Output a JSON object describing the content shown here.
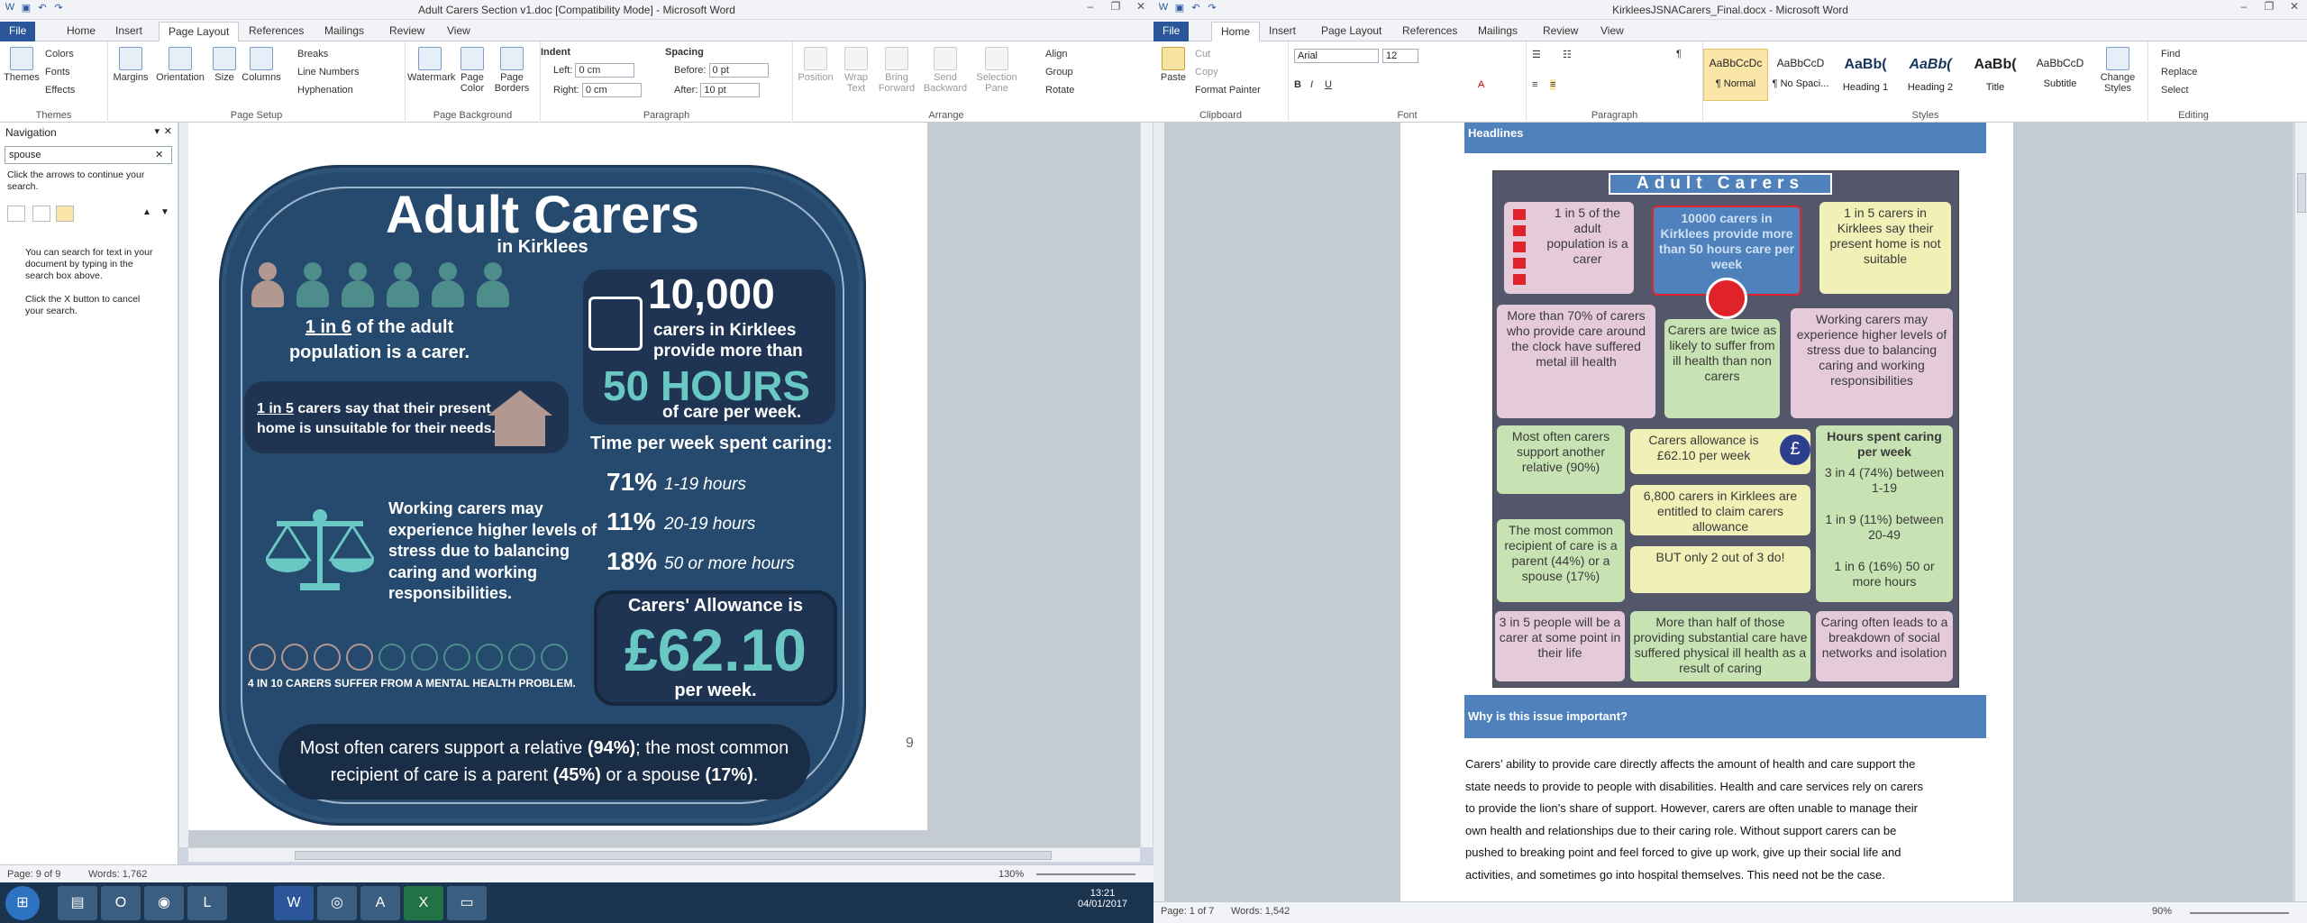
{
  "left_window": {
    "title": "Adult Carers Section v1.doc [Compatibility Mode] - Microsoft Word",
    "tabs": [
      "File",
      "Home",
      "Insert",
      "Page Layout",
      "References",
      "Mailings",
      "Review",
      "View"
    ],
    "active_tab": "Page Layout",
    "ribbon": {
      "themes": {
        "label": "Themes",
        "btn": "Themes",
        "colors": "Colors",
        "fonts": "Fonts",
        "effects": "Effects"
      },
      "page_setup": {
        "label": "Page Setup",
        "margins": "Margins",
        "orientation": "Orientation",
        "size": "Size",
        "columns": "Columns",
        "breaks": "Breaks",
        "line_numbers": "Line Numbers",
        "hyphenation": "Hyphenation"
      },
      "page_background": {
        "label": "Page Background",
        "watermark": "Watermark",
        "page_color": "Page Color",
        "page_borders": "Page Borders"
      },
      "paragraph": {
        "label": "Paragraph",
        "indent": "Indent",
        "left": "Left:",
        "left_val": "0 cm",
        "right": "Right:",
        "right_val": "0 cm",
        "spacing": "Spacing",
        "before": "Before:",
        "before_val": "0 pt",
        "after": "After:",
        "after_val": "10 pt"
      },
      "arrange": {
        "label": "Arrange",
        "position": "Position",
        "wrap": "Wrap Text",
        "bring": "Bring Forward",
        "send": "Send Backward",
        "selection": "Selection Pane",
        "align": "Align",
        "group": "Group",
        "rotate": "Rotate"
      }
    },
    "navigation": {
      "title": "Navigation",
      "search_value": "spouse",
      "hint": "Click the arrows to continue your search.",
      "info1": "You can search for text in your document by typing in the search box above.",
      "info2": "Click the X button to cancel your search."
    },
    "page_number": "9",
    "status": {
      "page": "Page: 9 of 9",
      "words": "Words: 1,762",
      "zoom": "130%"
    },
    "infographic": {
      "title": "Adult Carers",
      "subtitle": "in Kirklees",
      "one_in_6_a": "1 in 6",
      "one_in_6_b": " of the adult",
      "one_in_6_c": "population is a carer.",
      "big_num": "10,000",
      "carers_line1": "carers in Kirklees",
      "carers_line2": "provide more than",
      "fifty": "50 HOURS",
      "care_week": "of care per week.",
      "home_a": "1 in 5",
      "home_b": " carers say that their present",
      "home_c": "home is unsuitable for their needs.",
      "time_title": "Time per week spent caring:",
      "pct1": "71%",
      "pct1_l": "1-19 hours",
      "pct2": "11%",
      "pct2_l": "20-19 hours",
      "pct3": "18%",
      "pct3_l": "50 or more hours",
      "stress1": "Working carers may",
      "stress2": "experience higher levels of",
      "stress3": "stress due to balancing",
      "stress4": "caring and working",
      "stress5": "responsibilities.",
      "mental": "4 IN 10 CARERS SUFFER FROM A MENTAL HEALTH PROBLEM.",
      "allow_title": "Carers' Allowance is",
      "allow_value": "£62.10",
      "allow_per": "per week.",
      "relative_a": "Most often carers support a relative ",
      "relative_b": "(94%)",
      "relative_c": "; the most common",
      "relative_d": "recipient of care is a parent ",
      "relative_e": "(45%)",
      "relative_f": " or a spouse ",
      "relative_g": "(17%)",
      "relative_h": "."
    }
  },
  "right_window": {
    "title": "KirkleesJSNACarers_Final.docx - Microsoft Word",
    "tabs": [
      "File",
      "Home",
      "Insert",
      "Page Layout",
      "References",
      "Mailings",
      "Review",
      "View"
    ],
    "active_tab": "Home",
    "ribbon": {
      "clipboard": {
        "label": "Clipboard",
        "paste": "Paste",
        "cut": "Cut",
        "copy": "Copy",
        "format_painter": "Format Painter"
      },
      "font": {
        "label": "Font",
        "name": "Arial",
        "size": "12"
      },
      "paragraph": {
        "label": "Paragraph"
      },
      "styles": {
        "label": "Styles",
        "items": [
          {
            "sample": "AaBbCcDc",
            "name": "¶ Normal"
          },
          {
            "sample": "AaBbCcD",
            "name": "¶ No Spaci..."
          },
          {
            "sample": "AaBb(",
            "name": "Heading 1"
          },
          {
            "sample": "AaBb(",
            "name": "Heading 2"
          },
          {
            "sample": "AaBb(",
            "name": "Title"
          },
          {
            "sample": "AaBbCcD",
            "name": "Subtitle"
          }
        ],
        "change": "Change Styles"
      },
      "editing": {
        "label": "Editing",
        "find": "Find",
        "replace": "Replace",
        "select": "Select"
      }
    },
    "doc": {
      "headlines": "Headlines",
      "ig_title": "Adult Carers",
      "c1": "1 in 5 of the adult population is a carer",
      "c2": "10000 carers in Kirklees provide more than 50 hours care per week",
      "c3": "1 in 5 carers in Kirklees say their present home is not suitable",
      "c4": "More than 70% of carers who provide care around the clock have suffered metal ill health",
      "c5": "Carers are twice as likely to suffer from ill health than non carers",
      "c6": "Working carers may experience higher levels of stress due to balancing caring and working responsibilities",
      "c7": "Most often carers support another relative (90%)",
      "c8": "Carers allowance is £62.10 per week",
      "c9_title": "Hours spent caring per week",
      "c9a": "3 in 4 (74%) between 1-19",
      "c9b": "1 in 9 (11%) between 20-49",
      "c9c": "1 in 6 (16%) 50 or more hours",
      "c10": "6,800 carers in Kirklees are entitled to claim carers allowance",
      "c11": "The most common recipient of care is a parent (44%) or a spouse (17%)",
      "c12": "BUT only 2 out of 3 do!",
      "c13": "3 in 5 people will be a carer at some point in their life",
      "c14": "More than half of those providing substantial care have suffered physical ill health as a result of caring",
      "c15": "Caring often leads to a breakdown of social networks and isolation",
      "why": "Why is this issue important?",
      "para": [
        "Carers’ ability to provide care directly affects the amount of health and care support the",
        "state needs to provide to people with disabilities.  Health and care services rely on carers",
        "to provide the lion’s share of support.  However, carers are often unable to manage their",
        "own health and relationships due to their caring role.  Without support carers can be",
        "pushed to breaking point and feel forced to give up work, give up their social life and",
        "activities, and sometimes go into hospital themselves.  This need not be the case."
      ]
    },
    "status": {
      "page": "Page: 1 of 7",
      "words": "Words: 1,542",
      "zoom": "90%"
    }
  },
  "taskbar": {
    "time": "13:21",
    "date": "04/01/2017"
  },
  "colors": {
    "word_blue": "#2b579a",
    "ig_navy": "#264a6e",
    "ig_teal": "#6ac8c4",
    "band_blue": "#4f81bd"
  }
}
